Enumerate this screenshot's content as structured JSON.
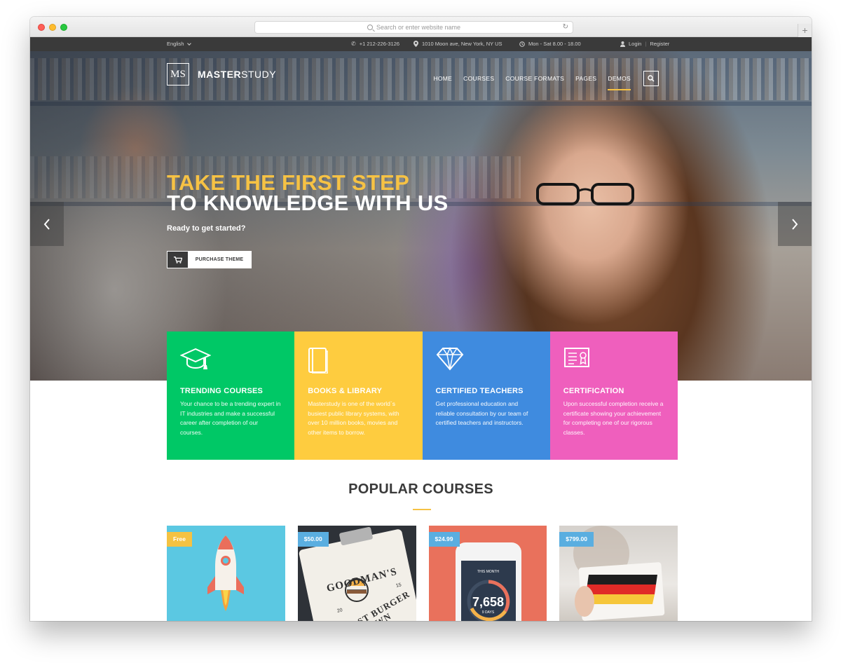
{
  "browser": {
    "url_placeholder": "Search or enter website name"
  },
  "topbar": {
    "language": "English",
    "phone": "+1 212-226-3126",
    "address": "1010 Moon ave, New York, NY US",
    "hours": "Mon - Sat 8.00 - 18.00",
    "login": "Login",
    "register": "Register"
  },
  "brand": {
    "monogram": "MS",
    "name_bold": "MASTER",
    "name_light": "STUDY"
  },
  "nav": {
    "items": [
      "HOME",
      "COURSES",
      "COURSE FORMATS",
      "PAGES",
      "DEMOS"
    ],
    "active": "DEMOS"
  },
  "hero": {
    "headline_line1": "TAKE THE FIRST STEP",
    "headline_line2": "TO KNOWLEDGE WITH US",
    "subline": "Ready to get started?",
    "cta_label": "PURCHASE THEME"
  },
  "features": [
    {
      "title": "TRENDING COURSES",
      "desc": "Your chance to be a trending expert in IT industries and make a successful career after completion of our courses.",
      "color": "#00c866",
      "icon": "graduation-cap-icon"
    },
    {
      "title": "BOOKS & LIBRARY",
      "desc": "Masterstudy is one of the world`s busiest public library systems, with over 10 million books, movies and other items to borrow.",
      "color": "#fecc3f",
      "icon": "book-icon"
    },
    {
      "title": "CERTIFIED TEACHERS",
      "desc": "Get professional education and reliable consultation by our team of certified teachers and instructors.",
      "color": "#3f8bdf",
      "icon": "diamond-icon"
    },
    {
      "title": "CERTIFICATION",
      "desc": "Upon successful completion receive a certificate showing your achievement for completing one of our rigorous classes.",
      "color": "#ef5fbd",
      "icon": "certificate-icon"
    }
  ],
  "popular": {
    "title": "POPULAR COURSES"
  },
  "courses": [
    {
      "price": "Free",
      "badge_color": "#f4c242",
      "bg": "#5bc8e2"
    },
    {
      "price": "$50.00",
      "badge_color": "#5aaee0",
      "bg": "#2e3238",
      "sign_top": "GOODMAN'S",
      "sign_bottom": "ST BURGER TOWN",
      "sign_num": "20",
      "sign_num2": "15"
    },
    {
      "price": "$24.99",
      "badge_color": "#5aaee0",
      "bg": "#e9715c",
      "phone_header": "THIS MONTH",
      "phone_value": "7,658",
      "phone_sub": "9 DAYS"
    },
    {
      "price": "$799.00",
      "badge_color": "#5aaee0",
      "bg": "#d9d6d2"
    }
  ],
  "colors": {
    "accent": "#f6c244",
    "topbar": "#3a3a3a"
  }
}
